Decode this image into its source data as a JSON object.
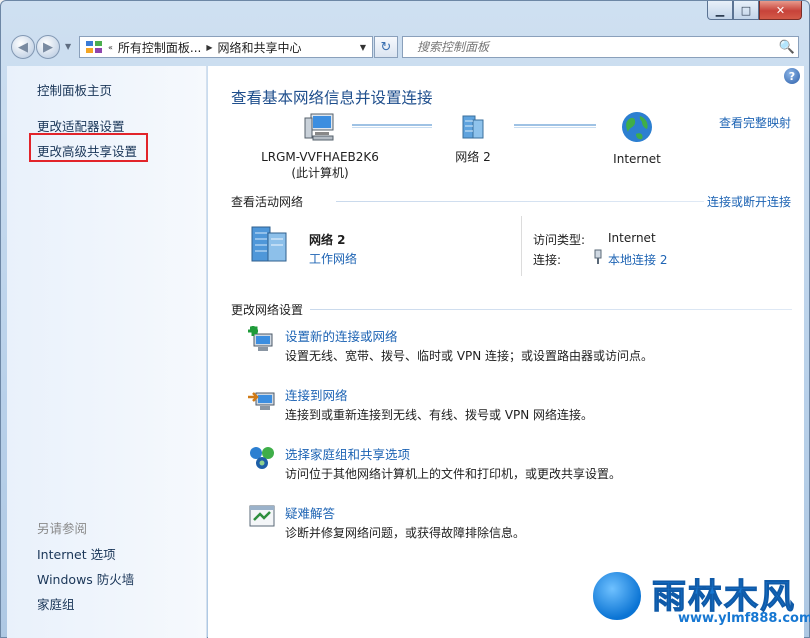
{
  "window": {
    "minimize": "▁",
    "maximize": "□",
    "close": "✕"
  },
  "nav": {
    "back_icon": "◀",
    "forward_icon": "▶",
    "address_prefix": "«",
    "address_seg1": "所有控制面板...",
    "address_sep": "▶",
    "address_seg2": "网络和共享中心",
    "dropdown_icon": "▼",
    "refresh_icon": "↻",
    "search_placeholder": "搜索控制面板",
    "search_icon": "🔍"
  },
  "sidebar": {
    "items": [
      {
        "label": "控制面板主页"
      },
      {
        "label": "更改适配器设置"
      },
      {
        "label": "更改高级共享设置"
      }
    ],
    "see_also_title": "另请参阅",
    "see_also": [
      {
        "label": "Internet 选项"
      },
      {
        "label": "Windows 防火墙"
      },
      {
        "label": "家庭组"
      }
    ]
  },
  "main": {
    "help_icon": "?",
    "title": "查看基本网络信息并设置连接",
    "map_link": "查看完整映射",
    "map": {
      "computer_name": "LRGM-VVFHAEB2K6",
      "computer_sub": "(此计算机)",
      "network_name": "网络  2",
      "internet": "Internet"
    },
    "active_section": "查看活动网络",
    "connect_link": "连接或断开连接",
    "active_network": {
      "name": "网络  2",
      "type": "工作网络",
      "access_type_label": "访问类型:",
      "access_type_value": "Internet",
      "connection_label": "连接:",
      "connection_value": "本地连接 2"
    },
    "change_section": "更改网络设置",
    "tasks": [
      {
        "link": "设置新的连接或网络",
        "desc": "设置无线、宽带、拨号、临时或 VPN 连接；或设置路由器或访问点。"
      },
      {
        "link": "连接到网络",
        "desc": "连接到或重新连接到无线、有线、拨号或 VPN 网络连接。"
      },
      {
        "link": "选择家庭组和共享选项",
        "desc": "访问位于其他网络计算机上的文件和打印机，或更改共享设置。"
      },
      {
        "link": "疑难解答",
        "desc": "诊断并修复网络问题，或获得故障排除信息。"
      }
    ]
  },
  "watermark": {
    "text": "雨林木风",
    "url": "www.ylmf888.com"
  },
  "colors": {
    "link": "#1e64b4",
    "title": "#1e4e8c",
    "highlight": "#e2242a"
  }
}
